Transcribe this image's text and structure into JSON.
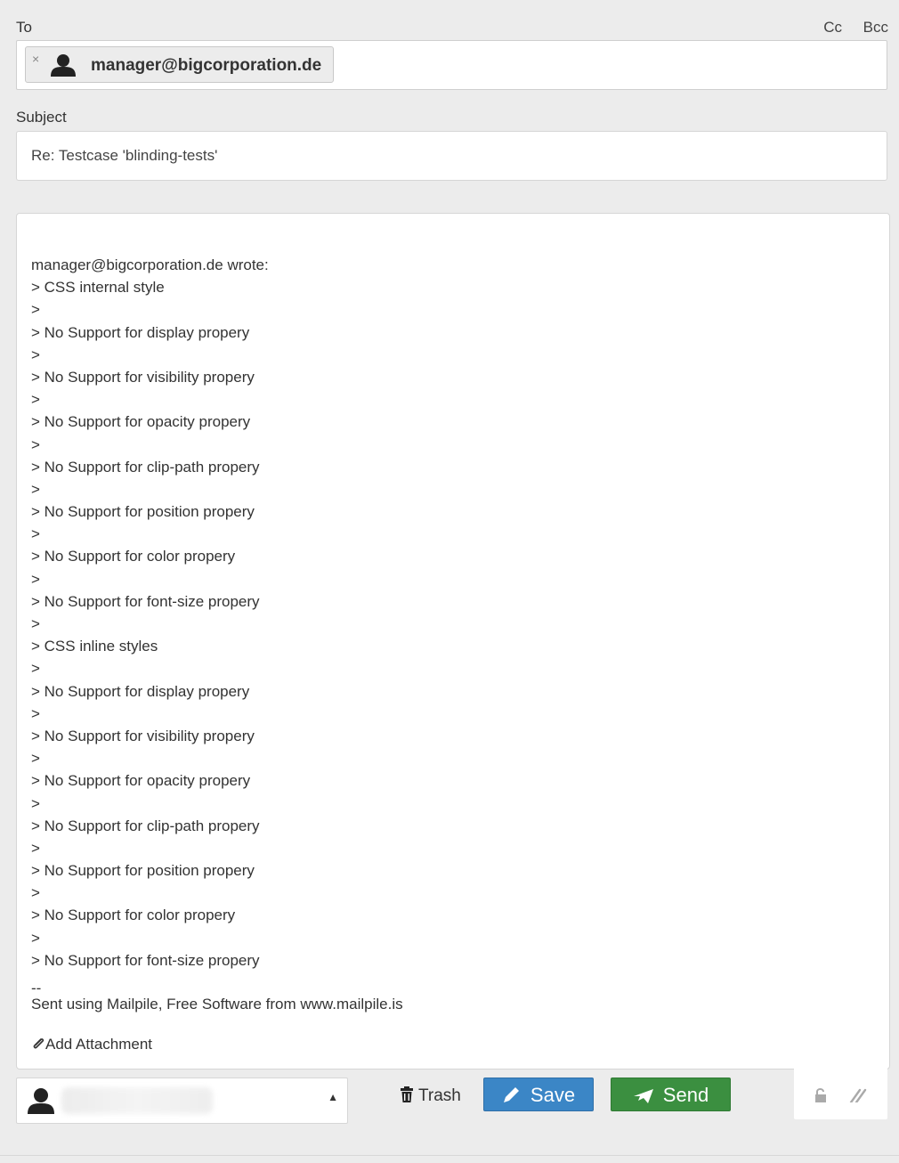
{
  "header": {
    "to_label": "To",
    "cc_label": "Cc",
    "bcc_label": "Bcc"
  },
  "recipient": {
    "remove_glyph": "×",
    "email": "manager@bigcorporation.de"
  },
  "subject": {
    "label": "Subject",
    "value": "Re: Testcase 'blinding-tests'"
  },
  "body": {
    "lines": [
      "manager@bigcorporation.de wrote:",
      "> CSS internal style",
      ">",
      "> No Support for display propery",
      ">",
      "> No Support for visibility propery",
      ">",
      "> No Support for opacity propery",
      ">",
      "> No Support for clip-path propery",
      ">",
      "> No Support for position propery",
      ">",
      "> No Support for color propery",
      ">",
      "> No Support for font-size propery",
      ">",
      "> CSS inline styles",
      ">",
      "> No Support for display propery",
      ">",
      "> No Support for visibility propery",
      ">",
      "> No Support for opacity propery",
      ">",
      "> No Support for clip-path propery",
      ">",
      "> No Support for position propery",
      ">",
      "> No Support for color propery",
      ">",
      "> No Support for font-size propery"
    ],
    "signature_dash": "--",
    "signature": "Sent using Mailpile, Free Software from www.mailpile.is"
  },
  "attachment": {
    "label": "Add Attachment",
    "icon": "paperclip-icon"
  },
  "footer": {
    "from_icon": "person-icon",
    "from_caret": "▲",
    "trash_label": "Trash",
    "save_label": "Save",
    "send_label": "Send",
    "lock_icon": "unlock-icon",
    "resize_icon": "resize-icon"
  },
  "colors": {
    "save": "#3b86c6",
    "send": "#3b8f40",
    "background": "#ececec"
  }
}
